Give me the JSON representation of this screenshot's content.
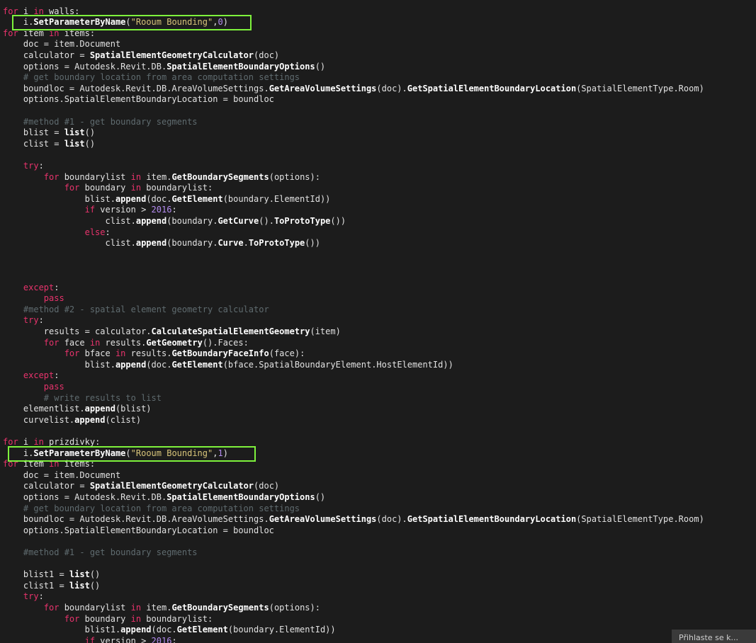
{
  "code_lines": [
    [
      [
        "kw",
        "for"
      ],
      [
        "pl",
        " i "
      ],
      [
        "kw",
        "in"
      ],
      [
        "pl",
        " walls:"
      ]
    ],
    [
      [
        "pl",
        "    i."
      ],
      [
        "fn",
        "SetParameterByName"
      ],
      [
        "pl",
        "("
      ],
      [
        "str",
        "\"Rooum Bounding\""
      ],
      [
        "pl",
        ","
      ],
      [
        "num",
        "0"
      ],
      [
        "pl",
        ")"
      ]
    ],
    [
      [
        "kw",
        "for"
      ],
      [
        "pl",
        " item "
      ],
      [
        "kw",
        "in"
      ],
      [
        "pl",
        " items:"
      ]
    ],
    [
      [
        "pl",
        "    doc = item.Document"
      ]
    ],
    [
      [
        "pl",
        "    calculator = "
      ],
      [
        "fn",
        "SpatialElementGeometryCalculator"
      ],
      [
        "pl",
        "(doc)"
      ]
    ],
    [
      [
        "pl",
        "    options = Autodesk.Revit.DB."
      ],
      [
        "fn",
        "SpatialElementBoundaryOptions"
      ],
      [
        "pl",
        "()"
      ]
    ],
    [
      [
        "cm",
        "    # get boundary location from area computation settings"
      ]
    ],
    [
      [
        "pl",
        "    boundloc = Autodesk.Revit.DB.AreaVolumeSettings."
      ],
      [
        "fn",
        "GetAreaVolumeSettings"
      ],
      [
        "pl",
        "(doc)."
      ],
      [
        "fn",
        "GetSpatialElementBoundaryLocation"
      ],
      [
        "pl",
        "(SpatialElementType.Room)"
      ]
    ],
    [
      [
        "pl",
        "    options.SpatialElementBoundaryLocation = boundloc"
      ]
    ],
    [],
    [
      [
        "cm",
        "    #method #1 - get boundary segments"
      ]
    ],
    [
      [
        "pl",
        "    blist = "
      ],
      [
        "fn",
        "list"
      ],
      [
        "pl",
        "()"
      ]
    ],
    [
      [
        "pl",
        "    clist = "
      ],
      [
        "fn",
        "list"
      ],
      [
        "pl",
        "()"
      ]
    ],
    [],
    [
      [
        "kw",
        "    try"
      ],
      [
        "pl",
        ":"
      ]
    ],
    [
      [
        "kw",
        "        for"
      ],
      [
        "pl",
        " boundarylist "
      ],
      [
        "kw",
        "in"
      ],
      [
        "pl",
        " item."
      ],
      [
        "fn",
        "GetBoundarySegments"
      ],
      [
        "pl",
        "(options):"
      ]
    ],
    [
      [
        "kw",
        "            for"
      ],
      [
        "pl",
        " boundary "
      ],
      [
        "kw",
        "in"
      ],
      [
        "pl",
        " boundarylist:"
      ]
    ],
    [
      [
        "pl",
        "                blist."
      ],
      [
        "fn",
        "append"
      ],
      [
        "pl",
        "(doc."
      ],
      [
        "fn",
        "GetElement"
      ],
      [
        "pl",
        "(boundary.ElementId))"
      ]
    ],
    [
      [
        "kw",
        "                if"
      ],
      [
        "pl",
        " version > "
      ],
      [
        "num",
        "2016"
      ],
      [
        "pl",
        ":"
      ]
    ],
    [
      [
        "pl",
        "                    clist."
      ],
      [
        "fn",
        "append"
      ],
      [
        "pl",
        "(boundary."
      ],
      [
        "fn",
        "GetCurve"
      ],
      [
        "pl",
        "()."
      ],
      [
        "fn",
        "ToProtoType"
      ],
      [
        "pl",
        "())"
      ]
    ],
    [
      [
        "kw",
        "                else"
      ],
      [
        "pl",
        ":"
      ]
    ],
    [
      [
        "pl",
        "                    clist."
      ],
      [
        "fn",
        "append"
      ],
      [
        "pl",
        "(boundary."
      ],
      [
        "fn",
        "Curve"
      ],
      [
        "pl",
        "."
      ],
      [
        "fn",
        "ToProtoType"
      ],
      [
        "pl",
        "())"
      ]
    ],
    [],
    [],
    [],
    [
      [
        "kw",
        "    except"
      ],
      [
        "pl",
        ":"
      ]
    ],
    [
      [
        "kw",
        "        pass"
      ]
    ],
    [
      [
        "cm",
        "    #method #2 - spatial element geometry calculator"
      ]
    ],
    [
      [
        "kw",
        "    try"
      ],
      [
        "pl",
        ":"
      ]
    ],
    [
      [
        "pl",
        "        results = calculator."
      ],
      [
        "fn",
        "CalculateSpatialElementGeometry"
      ],
      [
        "pl",
        "(item)"
      ]
    ],
    [
      [
        "kw",
        "        for"
      ],
      [
        "pl",
        " face "
      ],
      [
        "kw",
        "in"
      ],
      [
        "pl",
        " results."
      ],
      [
        "fn",
        "GetGeometry"
      ],
      [
        "pl",
        "().Faces:"
      ]
    ],
    [
      [
        "kw",
        "            for"
      ],
      [
        "pl",
        " bface "
      ],
      [
        "kw",
        "in"
      ],
      [
        "pl",
        " results."
      ],
      [
        "fn",
        "GetBoundaryFaceInfo"
      ],
      [
        "pl",
        "(face):"
      ]
    ],
    [
      [
        "pl",
        "                blist."
      ],
      [
        "fn",
        "append"
      ],
      [
        "pl",
        "(doc."
      ],
      [
        "fn",
        "GetElement"
      ],
      [
        "pl",
        "(bface.SpatialBoundaryElement.HostElementId))"
      ]
    ],
    [
      [
        "kw",
        "    except"
      ],
      [
        "pl",
        ":"
      ]
    ],
    [
      [
        "kw",
        "        pass"
      ]
    ],
    [
      [
        "cm",
        "        # write results to list"
      ]
    ],
    [
      [
        "pl",
        "    elementlist."
      ],
      [
        "fn",
        "append"
      ],
      [
        "pl",
        "(blist)"
      ]
    ],
    [
      [
        "pl",
        "    curvelist."
      ],
      [
        "fn",
        "append"
      ],
      [
        "pl",
        "(clist)"
      ]
    ],
    [],
    [
      [
        "kw",
        "for"
      ],
      [
        "pl",
        " i "
      ],
      [
        "kw",
        "in"
      ],
      [
        "pl",
        " prizdivky:"
      ]
    ],
    [
      [
        "pl",
        "    i."
      ],
      [
        "fn",
        "SetParameterByName"
      ],
      [
        "pl",
        "("
      ],
      [
        "str",
        "\"Rooum Bounding\""
      ],
      [
        "pl",
        ","
      ],
      [
        "num",
        "1"
      ],
      [
        "pl",
        ")"
      ]
    ],
    [
      [
        "kw",
        "for"
      ],
      [
        "pl",
        " item "
      ],
      [
        "kw",
        "in"
      ],
      [
        "pl",
        " items:"
      ]
    ],
    [
      [
        "pl",
        "    doc = item.Document"
      ]
    ],
    [
      [
        "pl",
        "    calculator = "
      ],
      [
        "fn",
        "SpatialElementGeometryCalculator"
      ],
      [
        "pl",
        "(doc)"
      ]
    ],
    [
      [
        "pl",
        "    options = Autodesk.Revit.DB."
      ],
      [
        "fn",
        "SpatialElementBoundaryOptions"
      ],
      [
        "pl",
        "()"
      ]
    ],
    [
      [
        "cm",
        "    # get boundary location from area computation settings"
      ]
    ],
    [
      [
        "pl",
        "    boundloc = Autodesk.Revit.DB.AreaVolumeSettings."
      ],
      [
        "fn",
        "GetAreaVolumeSettings"
      ],
      [
        "pl",
        "(doc)."
      ],
      [
        "fn",
        "GetSpatialElementBoundaryLocation"
      ],
      [
        "pl",
        "(SpatialElementType.Room)"
      ]
    ],
    [
      [
        "pl",
        "    options.SpatialElementBoundaryLocation = boundloc"
      ]
    ],
    [],
    [
      [
        "cm",
        "    #method #1 - get boundary segments"
      ]
    ],
    [],
    [
      [
        "pl",
        "    blist1 = "
      ],
      [
        "fn",
        "list"
      ],
      [
        "pl",
        "()"
      ]
    ],
    [
      [
        "pl",
        "    clist1 = "
      ],
      [
        "fn",
        "list"
      ],
      [
        "pl",
        "()"
      ]
    ],
    [
      [
        "kw",
        "    try"
      ],
      [
        "pl",
        ":"
      ]
    ],
    [
      [
        "kw",
        "        for"
      ],
      [
        "pl",
        " boundarylist "
      ],
      [
        "kw",
        "in"
      ],
      [
        "pl",
        " item."
      ],
      [
        "fn",
        "GetBoundarySegments"
      ],
      [
        "pl",
        "(options):"
      ]
    ],
    [
      [
        "kw",
        "            for"
      ],
      [
        "pl",
        " boundary "
      ],
      [
        "kw",
        "in"
      ],
      [
        "pl",
        " boundarylist:"
      ]
    ],
    [
      [
        "pl",
        "                blist1."
      ],
      [
        "fn",
        "append"
      ],
      [
        "pl",
        "(doc."
      ],
      [
        "fn",
        "GetElement"
      ],
      [
        "pl",
        "(boundary.ElementId))"
      ]
    ],
    [
      [
        "kw",
        "                if"
      ],
      [
        "pl",
        " version > "
      ],
      [
        "num",
        "2016"
      ],
      [
        "pl",
        ":"
      ]
    ]
  ],
  "highlight_lines": [
    1,
    40
  ],
  "colors": {
    "background": "#1c1c1c",
    "keyword": "#e8336c",
    "function": "#ffffff",
    "string": "#d8c47a",
    "number": "#b48cf0",
    "comment": "#5f6b6f",
    "highlight_box": "#7ef23c"
  },
  "notification": {
    "text": "Přihlaste se k..."
  }
}
